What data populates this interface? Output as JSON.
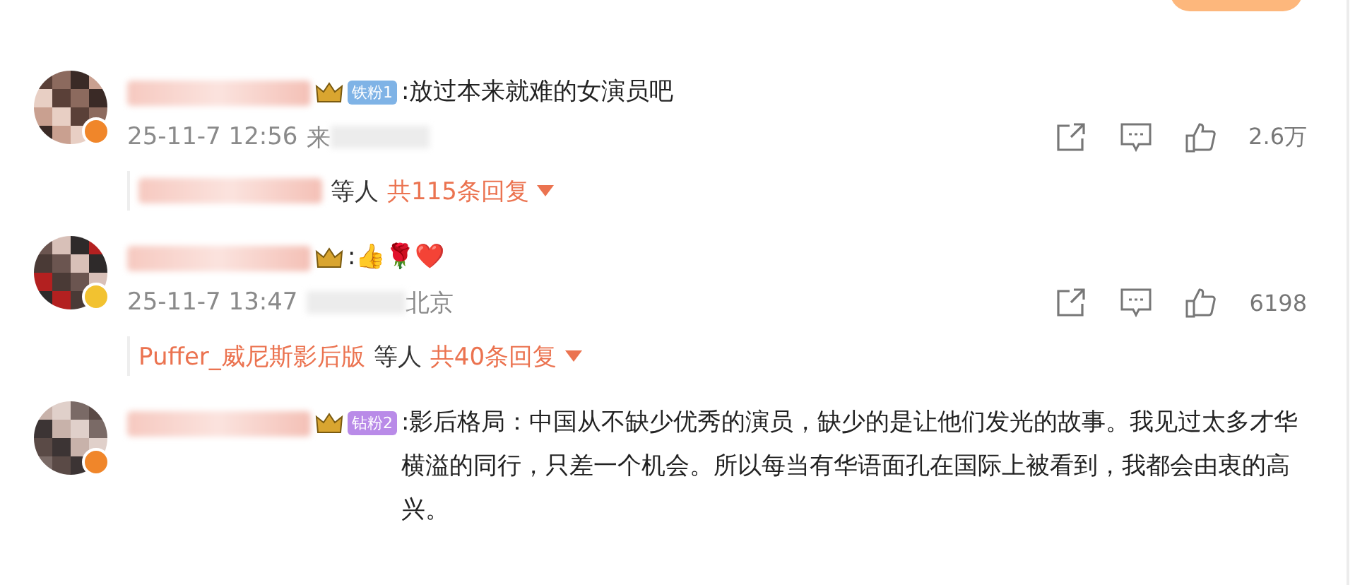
{
  "comments": [
    {
      "avatar": {
        "kind": "picture"
      },
      "verified": {
        "color": "#f0862a"
      },
      "crown": true,
      "fan_badge": {
        "text": "铁粉1",
        "color": "#7fb3e6"
      },
      "text": ":放过本来就难的女演员吧",
      "time": "25-11-7 12:56",
      "place_parts": [
        {
          "kind": "text",
          "text": "来"
        },
        {
          "kind": "blur"
        }
      ],
      "actions": {
        "likes": "2.6万"
      },
      "replies": {
        "names": [
          {
            "kind": "blur"
          }
        ],
        "suffix": "等人",
        "count": "共115条回复"
      }
    },
    {
      "avatar": {
        "kind": "picture"
      },
      "verified": {
        "color": "#f2c230"
      },
      "crown": true,
      "text": ":👍🌹❤️",
      "time": "25-11-7 13:47",
      "place_parts": [
        {
          "kind": "blur"
        },
        {
          "kind": "text",
          "text": "北京"
        }
      ],
      "actions": {
        "likes": "6198"
      },
      "replies": {
        "names": [
          {
            "kind": "text",
            "text": "Puffer_威尼斯影后版"
          }
        ],
        "suffix": "等人",
        "count": "共40条回复"
      }
    },
    {
      "avatar": {
        "kind": "picture"
      },
      "verified": {
        "color": "#f0862a"
      },
      "crown": true,
      "fan_badge": {
        "text": "钻粉2",
        "color": "#b98be8"
      },
      "text": ":影后格局：中国从不缺少优秀的演员，缺少的是让他们发光的故事。我见过太多才华横溢的同行，只差一个机会。所以每当有华语面孔在国际上被看到，我都会由衷的高兴。"
    }
  ]
}
